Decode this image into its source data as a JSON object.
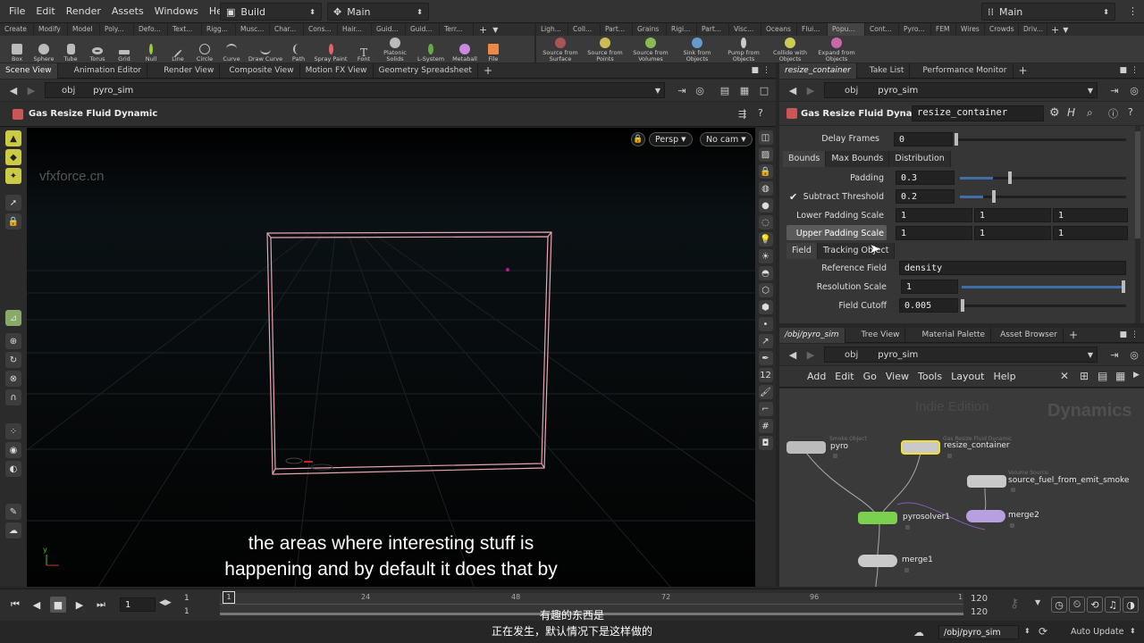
{
  "menubar": {
    "items": [
      "File",
      "Edit",
      "Render",
      "Assets",
      "Windows",
      "Help"
    ],
    "desktop_left": "Build",
    "desktop_mid": "Main",
    "desktop_right": "Main"
  },
  "shelf_left": {
    "tabs": [
      "Create",
      "Modify",
      "Model",
      "Poly...",
      "Defo...",
      "Text...",
      "Rigg...",
      "Musc...",
      "Char...",
      "Cons...",
      "Hair...",
      "Guid...",
      "Guid...",
      "Terr..."
    ],
    "tools": [
      "Box",
      "Sphere",
      "Tube",
      "Torus",
      "Grid",
      "Null",
      "Line",
      "Circle",
      "Curve",
      "Draw Curve",
      "Path",
      "Spray Paint",
      "Font",
      "Platonic Solids",
      "L-System",
      "Metaball",
      "File"
    ]
  },
  "shelf_right": {
    "tabs": [
      "Ligh...",
      "Coll...",
      "Part...",
      "Grains",
      "Rigi...",
      "Part...",
      "Visc...",
      "Oceans",
      "Flui...",
      "Popu...",
      "Cont...",
      "Pyro...",
      "FEM",
      "Wires",
      "Crowds",
      "Driv..."
    ],
    "tools": [
      "Source from Surface",
      "Source from Points",
      "Source from Volumes",
      "Sink from Objects",
      "Pump from Objects",
      "Collide with Objects",
      "Expand from Objects"
    ]
  },
  "left_pane": {
    "tabs": [
      "Scene View",
      "Animation Editor",
      "Render View",
      "Composite View",
      "Motion FX View",
      "Geometry Spreadsheet"
    ],
    "path_root": "obj",
    "path_node": "pyro_sim",
    "operator_title": "Gas Resize Fluid Dynamic",
    "viewport": {
      "watermark": "vfxforce.cn",
      "camera_mode": "Persp",
      "camera": "No cam",
      "axis_y": "y"
    }
  },
  "right_pane": {
    "tabs": [
      "resize_container",
      "Take List",
      "Performance Monitor"
    ],
    "path_root": "obj",
    "path_node": "pyro_sim",
    "operator_type": "Gas Resize Fluid Dynamic",
    "operator_name": "resize_container",
    "params": {
      "delay_frames": {
        "label": "Delay Frames",
        "value": "0"
      },
      "tabs": [
        "Bounds",
        "Max Bounds",
        "Distribution"
      ],
      "padding": {
        "label": "Padding",
        "value": "0.3",
        "fraction": 0.2
      },
      "subtract_threshold": {
        "label": "Subtract Threshold",
        "value": "0.2",
        "checked": true,
        "fraction": 0.14
      },
      "lower_padding_scale": {
        "label": "Lower Padding Scale",
        "values": [
          "1",
          "1",
          "1"
        ]
      },
      "upper_padding_scale": {
        "label": "Upper Padding Scale",
        "values": [
          "1",
          "1",
          "1"
        ]
      },
      "field_tabs": [
        "Field",
        "Tracking Object"
      ],
      "reference_field": {
        "label": "Reference Field",
        "value": "density"
      },
      "resolution_scale": {
        "label": "Resolution Scale",
        "value": "1",
        "fraction": 1.0
      },
      "field_cutoff": {
        "label": "Field Cutoff",
        "value": "0.005",
        "fraction": 0.0
      }
    }
  },
  "network_pane": {
    "tabs": [
      "/obj/pyro_sim",
      "Tree View",
      "Material Palette",
      "Asset Browser"
    ],
    "path_root": "obj",
    "path_node": "pyro_sim",
    "menu": [
      "Add",
      "Edit",
      "Go",
      "View",
      "Tools",
      "Layout",
      "Help"
    ],
    "watermark_edition": "Indie Edition",
    "watermark_context": "Dynamics",
    "nodes": {
      "pyro": {
        "label": "pyro",
        "type": "Smoke Object"
      },
      "resize_container": {
        "label": "resize_container",
        "type": "Gas Resize Fluid Dynamic"
      },
      "source": {
        "label": "source_fuel_from_emit_smoke",
        "type": "Volume Source"
      },
      "pyrosolver": {
        "label": "pyrosolver1",
        "type": ""
      },
      "merge2": {
        "label": "merge2",
        "type": ""
      },
      "merge1": {
        "label": "merge1",
        "type": ""
      }
    }
  },
  "timeline": {
    "current_frame": "1",
    "start_frame": "1",
    "start_frame2": "1",
    "end_frame": "120",
    "end_frame2": "120",
    "ticks": [
      "1",
      "24",
      "48",
      "72",
      "96",
      "1"
    ]
  },
  "statusbar": {
    "path": "/obj/pyro_sim",
    "update_mode": "Auto Update"
  },
  "subtitles": {
    "en_line1": "the areas where interesting stuff is",
    "en_line2": "happening and by default it does that by",
    "zh_line1": "有趣的东西是",
    "zh_line2": "正在发生，默认情况下是这样做的"
  }
}
